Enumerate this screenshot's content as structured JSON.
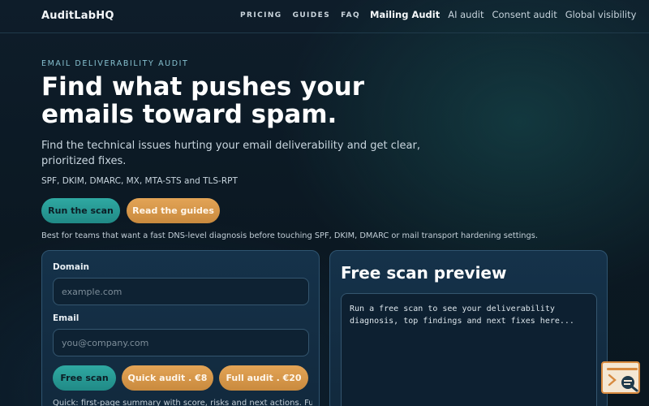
{
  "header": {
    "logo": "AuditLabHQ",
    "nav_small": [
      "PRICING",
      "GUIDES",
      "FAQ"
    ],
    "nav_main": [
      {
        "label": "Mailing Audit",
        "active": true
      },
      {
        "label": "AI audit",
        "active": false
      },
      {
        "label": "Consent audit",
        "active": false
      },
      {
        "label": "Global visibility",
        "active": false
      }
    ]
  },
  "hero": {
    "eyebrow": "EMAIL DELIVERABILITY AUDIT",
    "title": "Find what pushes your emails toward spam.",
    "subtitle": "Find the technical issues hurting your email deliverability and get clear, prioritized fixes.",
    "protocols": "SPF, DKIM, DMARC, MX, MTA-STS and TLS-RPT",
    "run_scan_label": "Run the scan",
    "read_guides_label": "Read the guides",
    "note": "Best for teams that want a fast DNS-level diagnosis before touching SPF, DKIM, DMARC or mail transport hardening settings."
  },
  "form": {
    "domain_label": "Domain",
    "domain_placeholder": "example.com",
    "domain_value": "",
    "email_label": "Email",
    "email_placeholder": "you@company.com",
    "email_value": "",
    "free_scan_label": "Free scan",
    "quick_audit_label": "Quick audit . €8",
    "full_audit_label": "Full audit . €20",
    "note": "Quick: first-page summary with score, risks and next actions. Full:"
  },
  "preview": {
    "title": "Free scan preview",
    "placeholder_text": "Run a free scan to see your deliverability diagnosis, top findings and next fixes here..."
  },
  "colors": {
    "accent_teal": "#2fa9a2",
    "accent_orange": "#e3a456",
    "background": "#0b1822"
  },
  "icons": {
    "chat_widget": "chat-search-widget-icon"
  }
}
